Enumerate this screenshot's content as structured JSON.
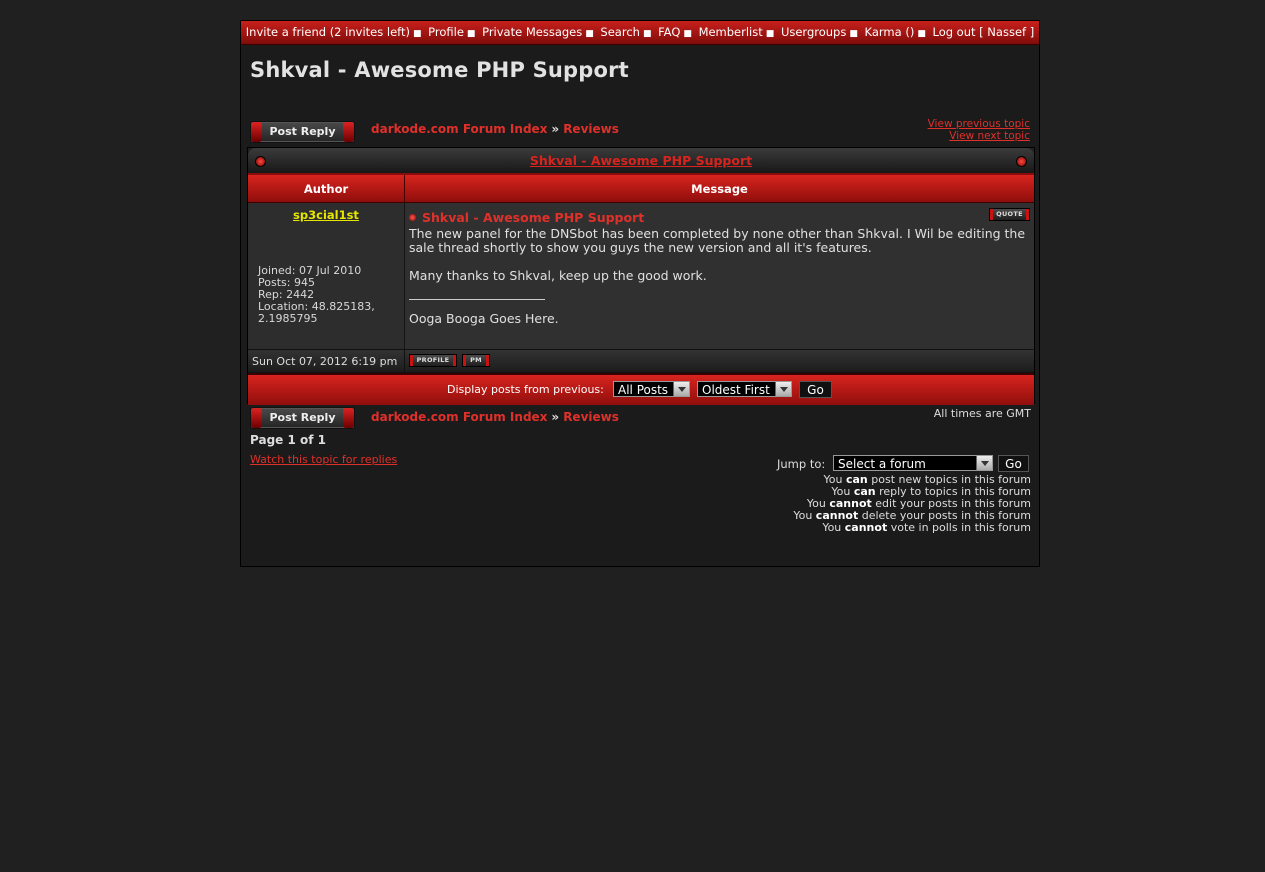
{
  "topnav": {
    "items": [
      "Invite a friend (2 invites left)",
      "Profile",
      "Private Messages",
      "Search",
      "FAQ",
      "Memberlist",
      "Usergroups",
      "Karma ()",
      "Log out [ Nassef ]"
    ]
  },
  "page_title": "Shkval - Awesome PHP Support",
  "post_reply_label": "Post Reply",
  "breadcrumb": {
    "forum_index": "darkode.com Forum Index",
    "separator": "»",
    "forum": "Reviews"
  },
  "topic_links": {
    "previous": "View previous topic",
    "next": "View next topic"
  },
  "topic_title": "Shkval - Awesome PHP Support",
  "table_headers": {
    "author": "Author",
    "message": "Message"
  },
  "post": {
    "author": "sp3cial1st",
    "joined": "Joined: 07 Jul 2010",
    "posts": "Posts: 945",
    "rep": "Rep: 2442",
    "location_1": "Location: 48.825183,",
    "location_2": "2.1985795",
    "subject": "Shkval - Awesome PHP Support",
    "quote_label": "QUOTE",
    "body_1": "The new panel for the DNSbot has been completed by none other than Shkval. I Wil be editing the sale thread shortly to show you guys the new version and all it's features.",
    "body_2": "Many thanks to Shkval, keep up the good work.",
    "signature": "Ooga Booga Goes Here.",
    "date": "Sun Oct 07, 2012 6:19 pm",
    "profile_label": "PROFILE",
    "pm_label": "PM"
  },
  "display": {
    "label": "Display posts from previous:",
    "posts_selected": "All Posts",
    "order_selected": "Oldest First",
    "go_label": "Go"
  },
  "gmt": "All times are GMT",
  "page_count": "Page 1 of 1",
  "watch_link": "Watch this topic for replies",
  "jump": {
    "label": "Jump to:",
    "selected": "Select a forum",
    "go_label": "Go"
  },
  "permissions": [
    {
      "pre": "You ",
      "strong": "can",
      "post": " post new topics in this forum"
    },
    {
      "pre": "You ",
      "strong": "can",
      "post": " reply to topics in this forum"
    },
    {
      "pre": "You ",
      "strong": "cannot",
      "post": " edit your posts in this forum"
    },
    {
      "pre": "You ",
      "strong": "cannot",
      "post": " delete your posts in this forum"
    },
    {
      "pre": "You ",
      "strong": "cannot",
      "post": " vote in polls in this forum"
    }
  ],
  "colors": {
    "accent_red": "#d8241e",
    "link_red": "#e0302a",
    "username_yellow": "#e6e600",
    "background": "#202020"
  }
}
